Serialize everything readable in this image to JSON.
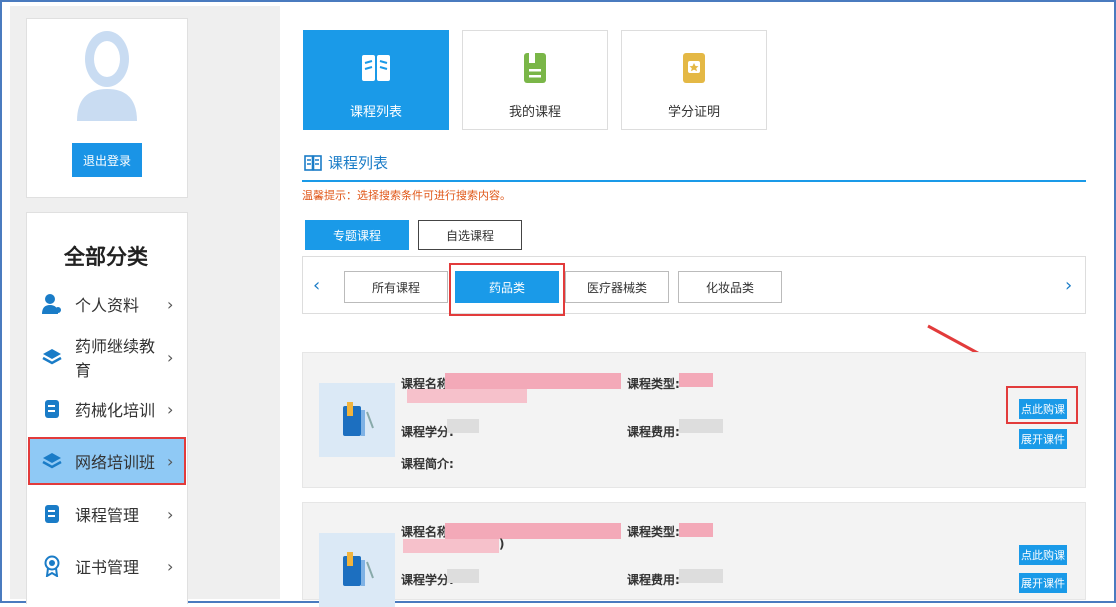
{
  "profile": {
    "logout_label": "退出登录"
  },
  "categories": {
    "title": "全部分类",
    "items": [
      {
        "label": "个人资料",
        "icon": "user-icon"
      },
      {
        "label": "药师继续教育",
        "icon": "layers-icon"
      },
      {
        "label": "药械化培训",
        "icon": "document-icon"
      },
      {
        "label": "网络培训班",
        "icon": "layers-icon",
        "active": true
      },
      {
        "label": "课程管理",
        "icon": "document-icon"
      },
      {
        "label": "证书管理",
        "icon": "certificate-icon"
      }
    ],
    "chevron": "›"
  },
  "tiles": [
    {
      "label": "课程列表",
      "icon": "book-icon"
    },
    {
      "label": "我的课程",
      "icon": "notebook-icon"
    },
    {
      "label": "学分证明",
      "icon": "credit-certificate-icon"
    }
  ],
  "section": {
    "title": "课程列表",
    "tip": "温馨提示：选择搜索条件可进行搜索内容。"
  },
  "course_types": [
    "专题课程",
    "自选课程"
  ],
  "category_filters": {
    "prev": "‹",
    "next": "›",
    "items": [
      "所有课程",
      "药品类",
      "医疗器械类",
      "化妆品类"
    ],
    "selected": "药品类"
  },
  "course_card": {
    "name_label": "课程名称:",
    "type_label": "课程类型:",
    "credit_label": "课程学分:",
    "fee_label": "课程费用:",
    "intro_label": "课程简介:",
    "buy_label": "点此购课",
    "expand_label": "展开课件",
    "second_name_suffix": ")"
  },
  "colors": {
    "accent": "#1a9ae8",
    "highlight": "#e23b3b",
    "tip": "#e0581a"
  }
}
